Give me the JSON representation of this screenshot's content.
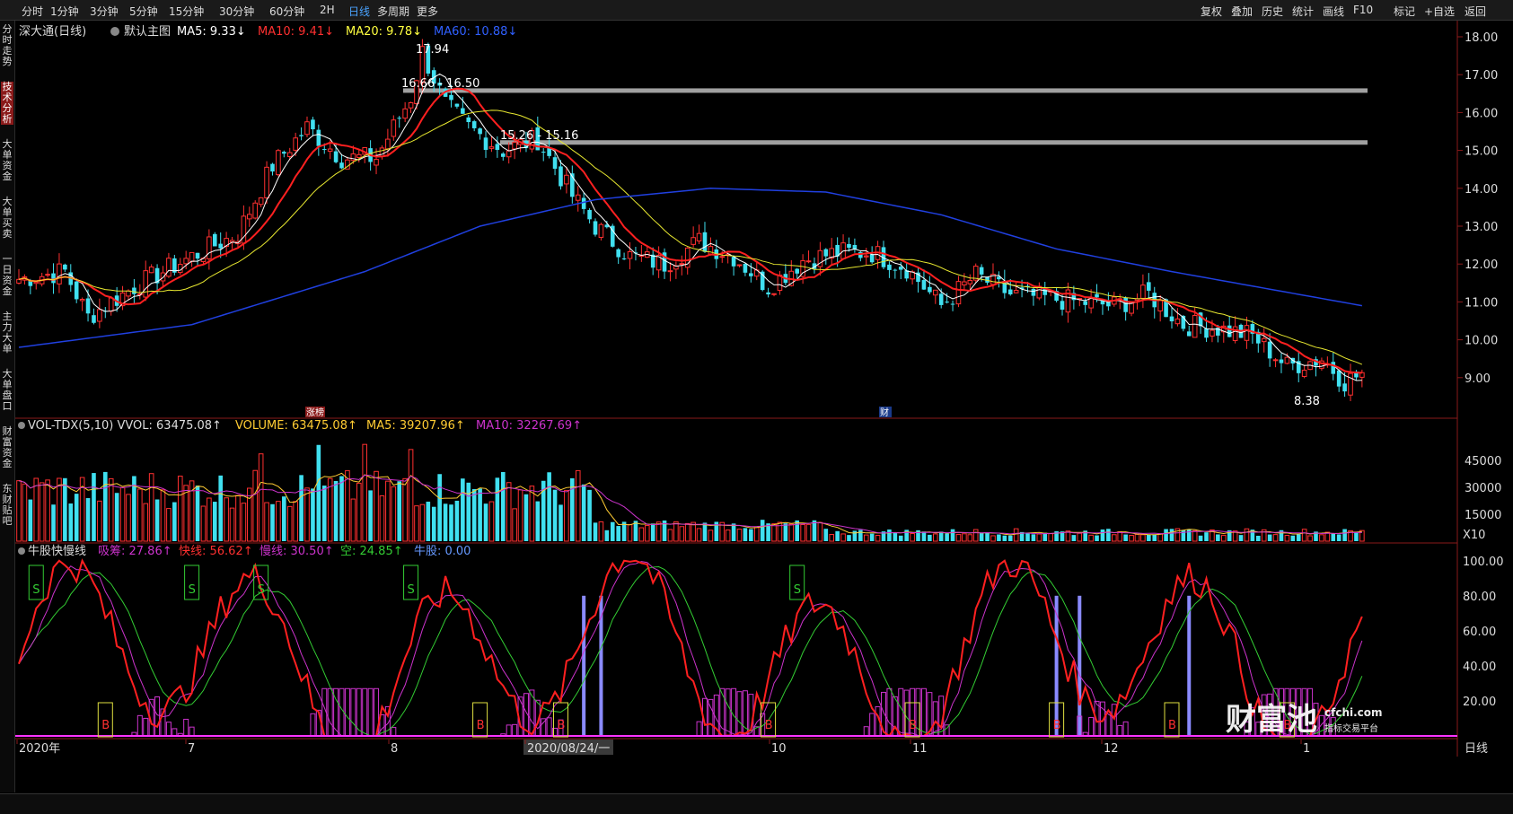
{
  "topbar": {
    "periods": [
      "分时",
      "1分钟",
      "3分钟",
      "5分钟",
      "15分钟",
      "30分钟",
      "60分钟",
      "2H",
      "日线",
      "多周期",
      "更多"
    ],
    "active_period": "日线",
    "tools": [
      "复权",
      "叠加",
      "历史",
      "统计",
      "画线",
      "F10",
      "标记",
      "+自选",
      "返回"
    ]
  },
  "sidebar": [
    "分时走势",
    "技术分析",
    "大单资金",
    "大单买卖",
    "一日资金",
    "主力大单",
    "大单盘口",
    "财富资金",
    "东财贴吧"
  ],
  "sidebar_active": "技术分析",
  "main_panel": {
    "stock_name": "深大通(日线)",
    "template": "默认主图",
    "indicators": [
      {
        "text": "MA5: 9.33↓",
        "color": "#ffffff"
      },
      {
        "text": "MA10: 9.41↓",
        "color": "#ff3030"
      },
      {
        "text": "MA20: 9.78↓",
        "color": "#ffff40"
      },
      {
        "text": "MA60: 10.88↓",
        "color": "#3060ff"
      }
    ],
    "annotations": {
      "high": "17.94",
      "low": "8.38",
      "band1": "16.66 - 16.50",
      "band2": "15.26 - 15.16",
      "tag_zt": "涨榜",
      "tag_cai": "财"
    },
    "y_ticks": [
      "18.00",
      "17.00",
      "16.00",
      "15.00",
      "14.00",
      "13.00",
      "12.00",
      "11.00",
      "10.00",
      "9.00"
    ]
  },
  "volume_panel": {
    "title": "VOL-TDX(5,10) VVOL: 63475.08↑",
    "indicators": [
      {
        "text": "VOLUME: 63475.08↑",
        "color": "#ffcc33"
      },
      {
        "text": "MA5: 39207.96↑",
        "color": "#ffcc33"
      },
      {
        "text": "MA10: 32267.69↑",
        "color": "#cc33cc"
      }
    ],
    "y_ticks": [
      "45000",
      "30000",
      "15000"
    ],
    "unit": "X10"
  },
  "oscillator_panel": {
    "title": "牛股快慢线",
    "indicators": [
      {
        "text": "吸筹: 27.86↑",
        "color": "#cc33cc"
      },
      {
        "text": "快线: 56.62↑",
        "color": "#ff3030"
      },
      {
        "text": "慢线: 30.50↑",
        "color": "#cc33cc"
      },
      {
        "text": "空: 24.85↑",
        "color": "#33cc33"
      },
      {
        "text": "牛股: 0.00",
        "color": "#6699ff"
      }
    ],
    "y_ticks": [
      "100.00",
      "80.00",
      "60.00",
      "40.00",
      "20.00"
    ],
    "signal_s": "S",
    "signal_b": "B"
  },
  "x_axis": {
    "labels": [
      "2020年",
      "7",
      "8",
      "2020/08/24/一",
      "10",
      "11",
      "12",
      "1"
    ],
    "period_label": "日线"
  },
  "watermark": {
    "brand": "财富池",
    "site": "cfchi.com",
    "slogan": "指标交易平台"
  },
  "colors": {
    "up": "#ff3030",
    "down": "#40e0f0",
    "ma5": "#ffffff",
    "ma10": "#ff2020",
    "ma20": "#e8e830",
    "ma60": "#2040e0",
    "band": "#a0a0a0",
    "active_blue": "#4aa3ff"
  },
  "chart_data": {
    "type": "candlestick",
    "title": "深大通(日线)",
    "price_range": [
      8.38,
      17.94
    ],
    "price_ylim": [
      8.5,
      18.2
    ],
    "price_keypoints": [
      {
        "i": 0,
        "price": 11.6
      },
      {
        "i": 8,
        "price": 11.8
      },
      {
        "i": 12,
        "price": 10.6
      },
      {
        "i": 20,
        "price": 11.4
      },
      {
        "i": 30,
        "price": 12.2
      },
      {
        "i": 38,
        "price": 12.8
      },
      {
        "i": 44,
        "price": 14.6
      },
      {
        "i": 50,
        "price": 15.6
      },
      {
        "i": 56,
        "price": 14.8
      },
      {
        "i": 62,
        "price": 14.8
      },
      {
        "i": 68,
        "price": 16.4
      },
      {
        "i": 70,
        "price": 17.6
      },
      {
        "i": 74,
        "price": 16.2
      },
      {
        "i": 78,
        "price": 15.6
      },
      {
        "i": 84,
        "price": 15.0
      },
      {
        "i": 90,
        "price": 15.3
      },
      {
        "i": 96,
        "price": 13.8
      },
      {
        "i": 100,
        "price": 13.0
      },
      {
        "i": 106,
        "price": 12.2
      },
      {
        "i": 112,
        "price": 12.0
      },
      {
        "i": 118,
        "price": 12.6
      },
      {
        "i": 124,
        "price": 12.2
      },
      {
        "i": 130,
        "price": 11.4
      },
      {
        "i": 136,
        "price": 12.1
      },
      {
        "i": 142,
        "price": 12.3
      },
      {
        "i": 148,
        "price": 12.3
      },
      {
        "i": 154,
        "price": 11.9
      },
      {
        "i": 160,
        "price": 10.9
      },
      {
        "i": 166,
        "price": 11.7
      },
      {
        "i": 172,
        "price": 11.2
      },
      {
        "i": 178,
        "price": 11.1
      },
      {
        "i": 184,
        "price": 11.0
      },
      {
        "i": 190,
        "price": 10.9
      },
      {
        "i": 196,
        "price": 11.2
      },
      {
        "i": 202,
        "price": 10.4
      },
      {
        "i": 208,
        "price": 10.3
      },
      {
        "i": 214,
        "price": 10.1
      },
      {
        "i": 220,
        "price": 9.3
      },
      {
        "i": 226,
        "price": 9.5
      },
      {
        "i": 230,
        "price": 8.9
      },
      {
        "i": 233,
        "price": 9.1
      }
    ],
    "ma60_keypoints": [
      {
        "i": 0,
        "price": 9.8
      },
      {
        "i": 30,
        "price": 10.4
      },
      {
        "i": 60,
        "price": 11.8
      },
      {
        "i": 80,
        "price": 13.0
      },
      {
        "i": 100,
        "price": 13.7
      },
      {
        "i": 120,
        "price": 14.0
      },
      {
        "i": 140,
        "price": 13.9
      },
      {
        "i": 160,
        "price": 13.3
      },
      {
        "i": 180,
        "price": 12.4
      },
      {
        "i": 200,
        "price": 11.8
      },
      {
        "i": 233,
        "price": 10.9
      }
    ],
    "volume_ylim": [
      0,
      55000
    ],
    "oscillator_ylim": [
      0,
      105
    ],
    "s_signal_indices": [
      3,
      30,
      42,
      68,
      135
    ],
    "b_signal_indices": [
      15,
      80,
      94,
      130,
      155,
      180,
      200,
      220
    ],
    "bull_bar_indices": [
      98,
      101,
      180,
      184,
      203
    ]
  }
}
